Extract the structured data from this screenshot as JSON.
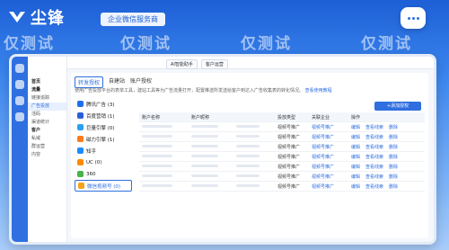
{
  "brand": {
    "name": "尘锋",
    "slogan": "企业微信服务商"
  },
  "watermark": "仅测试",
  "top_tabs": [
    "AI智能助手",
    "客户运营"
  ],
  "sidebar_nav": [
    "首页",
    "流量",
    "链接追踪",
    "广告投放",
    "活码",
    "渠道统计",
    "客户",
    "私域",
    "群运营",
    "内容"
  ],
  "subtabs": [
    "转发授权",
    "自建站",
    "账户授权"
  ],
  "description": "使用广告投放平台的表单工具，建站工具等为广告流量打开，配置推送所发送给客户到达入广告收集表的转化情况。",
  "help_link": "查看使用教程",
  "primary_button": "+添加授权",
  "platforms": [
    {
      "name": "腾讯广告 (3)",
      "color": "#1f6ef0"
    },
    {
      "name": "百度营销 (1)",
      "color": "#2b5fd8"
    },
    {
      "name": "巨量引擎 (0)",
      "color": "#2aa0f0"
    },
    {
      "name": "磁力引擎 (1)",
      "color": "#ff7a1a"
    },
    {
      "name": "知乎",
      "color": "#1a8cff"
    },
    {
      "name": "UC (0)",
      "color": "#ff8a00"
    },
    {
      "name": "360",
      "color": "#49b34b"
    },
    {
      "name": "微信视频号 (0)",
      "color": "#f4a11c"
    }
  ],
  "table": {
    "headers": [
      "账户名称",
      "账户昵称",
      "投放类型",
      "关联企业",
      "操作"
    ],
    "rows": [
      [
        "视频号推广",
        "视频号推广",
        "视频号推广"
      ],
      [
        "视频号推广",
        "视频号推广",
        "视频号推广"
      ],
      [
        "视频号推广",
        "视频号推广",
        "视频号推广"
      ],
      [
        "视频号推广",
        "视频号推广",
        "视频号推广"
      ],
      [
        "视频号推广",
        "视频号推广",
        "视频号推广"
      ],
      [
        "视频号推广",
        "视频号推广",
        "视频号推广"
      ],
      [
        "视频号推广",
        "视频号推广",
        "视频号推广"
      ]
    ],
    "actions": [
      "编辑",
      "查看线索",
      "删除"
    ]
  }
}
